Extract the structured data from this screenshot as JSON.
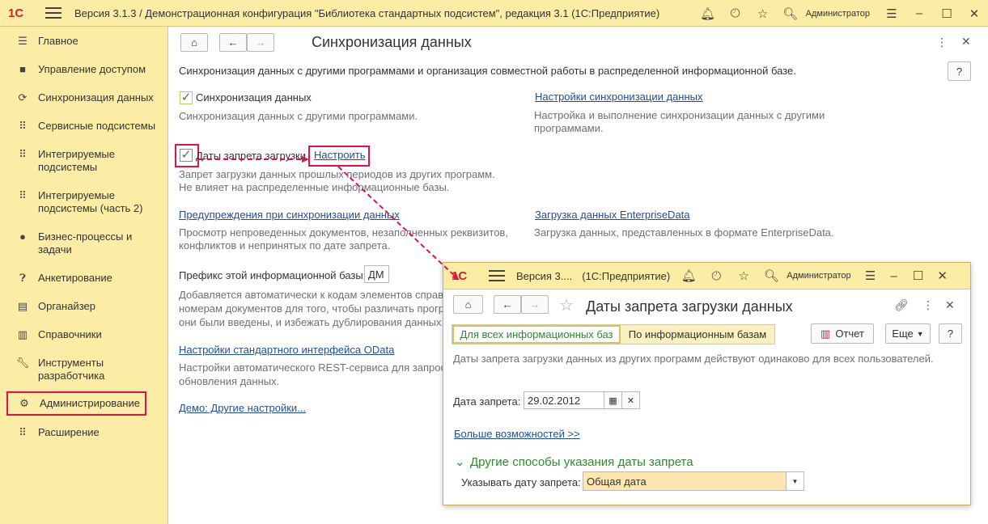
{
  "app": {
    "logo": "1С",
    "title": "Версия 3.1.3 / Демонстрационная конфигурация \"Библиотека стандартных подсистем\", редакция 3.1  (1С:Предприятие)",
    "user": "Администратор"
  },
  "sidebar": {
    "items": [
      {
        "label": "Главное",
        "icon": "menu-icon",
        "glyph": "☰"
      },
      {
        "label": "Управление доступом",
        "icon": "lock-icon",
        "glyph": "🔒"
      },
      {
        "label": "Синхронизация данных",
        "icon": "sync-icon",
        "glyph": "⟳"
      },
      {
        "label": "Сервисные подсистемы",
        "icon": "services-icon",
        "glyph": "⠿"
      },
      {
        "label": "Интегрируемые подсистемы",
        "icon": "integrated-icon",
        "glyph": "⠿"
      },
      {
        "label": "Интегрируемые подсистемы (часть 2)",
        "icon": "integrated-icon",
        "glyph": "⠿"
      },
      {
        "label": "Бизнес-процессы и задачи",
        "icon": "people-icon",
        "glyph": "👥"
      },
      {
        "label": "Анкетирование",
        "icon": "question-icon",
        "glyph": "❓"
      },
      {
        "label": "Органайзер",
        "icon": "notebook-icon",
        "glyph": "📋"
      },
      {
        "label": "Справочники",
        "icon": "books-icon",
        "glyph": "📚"
      },
      {
        "label": "Инструменты разработчика",
        "icon": "wrench-icon",
        "glyph": "🔧"
      },
      {
        "label": "Администрирование",
        "icon": "gear-icon",
        "glyph": "⚙"
      },
      {
        "label": "Расширение",
        "icon": "extension-icon",
        "glyph": "⠿"
      }
    ]
  },
  "main": {
    "title": "Синхронизация данных",
    "intro": "Синхронизация данных с другими программами и организация совместной работы в распределенной информационной базе.",
    "help": "?",
    "sync_checkbox_label": "Синхронизация данных",
    "sync_desc": "Синхронизация данных с другими программами.",
    "sync_settings_link": "Настройки синхронизации данных",
    "sync_settings_desc1": "Настройка и выполнение синхронизации данных с другими",
    "sync_settings_desc2": "программами.",
    "ban_checkbox_label": "Даты запрета загрузки",
    "ban_configure_link": "Настроить",
    "ban_desc1": "Запрет загрузки данных прошлых периодов из других программ.",
    "ban_desc2": "Не влияет на распределенные информационные базы.",
    "warnings_link": "Предупреждения при синхронизации данных",
    "warnings_desc1": "Просмотр непроведенных документов, незаполненных реквизитов,",
    "warnings_desc2": "конфликтов и непринятых по дате запрета.",
    "enterprise_link": "Загрузка данных EnterpriseData",
    "enterprise_desc": "Загрузка данных, представленных в формате EnterpriseData.",
    "prefix_label": "Префикс этой информационной базы:",
    "prefix_value": "ДМ",
    "prefix_desc1": "Добавляется автоматически к кодам элементов справ",
    "prefix_desc2": "номерам документов для того, чтобы различать програ",
    "prefix_desc3": "они были введены, и избежать дублирования данных.",
    "odata_link": "Настройки стандартного интерфейса OData",
    "odata_desc1": "Настройки автоматического REST-сервиса для запрос",
    "odata_desc2": "обновления данных.",
    "demo_link": "Демо: Другие настройки..."
  },
  "popup": {
    "title_short": "Версия 3....",
    "title_app": "(1С:Предприятие)",
    "user": "Администратор",
    "form_title": "Даты запрета загрузки данных",
    "tab_all": "Для всех информационных баз",
    "tab_by_base": "По информационным базам",
    "report_button": "Отчет",
    "more_button": "Еще",
    "help": "?",
    "info": "Даты запрета загрузки данных из других программ действуют одинаково для всех пользователей.",
    "date_label": "Дата запрета:",
    "date_value": "29.02.2012",
    "more_link": "Больше возможностей >>",
    "other_methods": "Другие способы указания даты запрета",
    "specify_label": "Указывать дату запрета:",
    "specify_value": "Общая дата"
  },
  "colors": {
    "highlight": "#e3104a",
    "panel": "#fbeda6",
    "link": "#1f4e9e",
    "check": "#2a8c2a"
  }
}
